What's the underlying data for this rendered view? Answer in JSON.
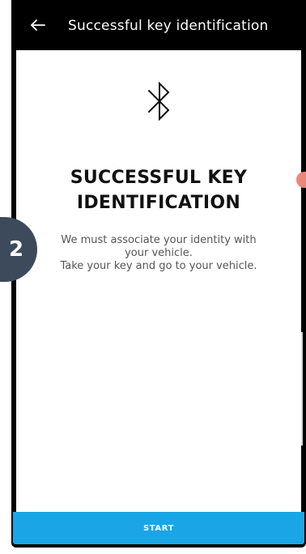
{
  "header": {
    "title": "Successful key identification",
    "back_icon": "back-arrow-icon"
  },
  "main": {
    "icon": "bluetooth-icon",
    "title_line1": "SUCCESSFUL KEY",
    "title_line2": "IDENTIFICATION",
    "description_line1": "We must associate your identity with",
    "description_line2": "your vehicle.",
    "description_line3": "Take your key and go to your vehicle."
  },
  "footer": {
    "start_label": "START"
  },
  "overlay": {
    "step_number": "2"
  },
  "colors": {
    "header_bg": "#000000",
    "accent": "#1aa5e6",
    "badge": "#3c4a5c",
    "title_text": "#111111",
    "body_text": "#555555"
  }
}
